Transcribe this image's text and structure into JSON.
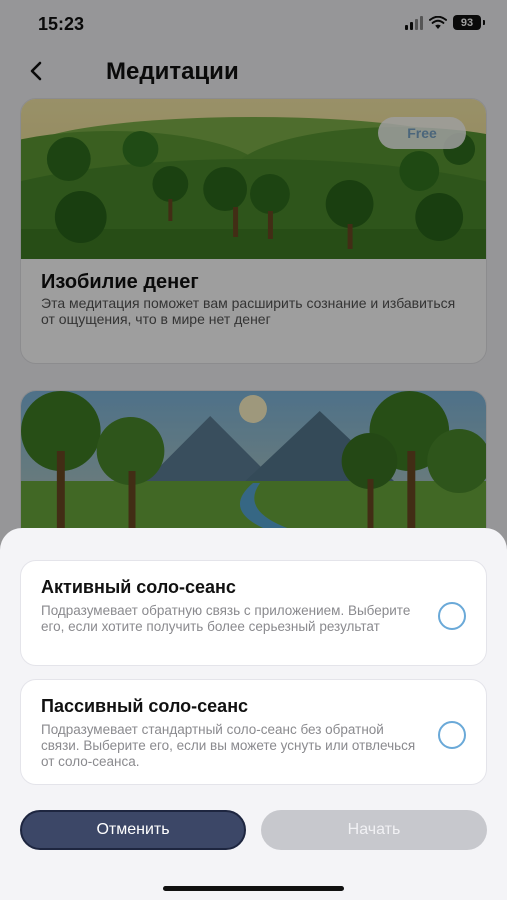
{
  "status_bar": {
    "time": "15:23",
    "battery": "93",
    "icons": [
      "signal-icon",
      "wifi-icon",
      "battery-icon"
    ]
  },
  "header": {
    "title": "Медитации",
    "back_icon": "chevron-left-icon"
  },
  "cards": [
    {
      "badge": "Free",
      "title": "Изобилие денег",
      "description": "Эта медитация поможет вам расширить сознание и избавиться от ощущения, что в мире нет денег"
    },
    {
      "badge": "",
      "title": "",
      "description": ""
    }
  ],
  "sheet": {
    "options": [
      {
        "title": "Активный соло-сеанс",
        "description": "Подразумевает обратную связь с приложением. Выберите его, если хотите получить более серьезный результат",
        "selected": false
      },
      {
        "title": "Пассивный соло-сеанс",
        "description": "Подразумевает стандартный соло-сеанс без обратной связи. Выберите его, если вы можете уснуть или отвлечься от соло-сеанса.",
        "selected": false
      }
    ],
    "cancel_label": "Отменить",
    "start_label": "Начать"
  },
  "colors": {
    "accent": "#6aa9d8",
    "primary_button": "#3c4767",
    "disabled_button": "#c7c8cd"
  }
}
